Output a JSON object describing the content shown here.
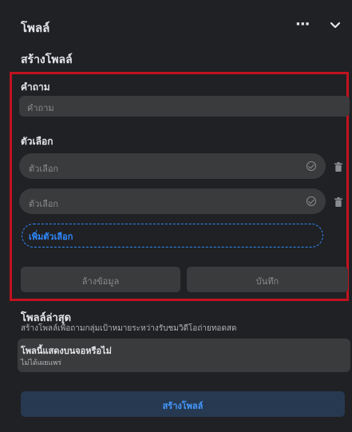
{
  "header": {
    "title": "โพลล์",
    "more_label": "···"
  },
  "subtitle": "สร้างโพลล์",
  "form": {
    "question_label": "คำถาม",
    "question_placeholder": "คำถาม",
    "options_label": "ตัวเลือก",
    "options": [
      {
        "placeholder": "ตัวเลือก"
      },
      {
        "placeholder": "ตัวเลือก"
      }
    ],
    "add_option_label": "เพิ่มตัวเลือก",
    "clear_label": "ล้างข้อมูล",
    "save_label": "บันทึก"
  },
  "recent": {
    "title": "โพลล์ล่าสุด",
    "description": "สร้างโพลล์เพื่อถามกลุ่มเป้าหมายระหว่างรับชมวิดีโอถ่ายทอดสด"
  },
  "display_card": {
    "title": "โพลนี้แสดงบนจอหรือไม่",
    "subtitle": "ไม่ได้เผยแพร่"
  },
  "create_label": "สร้างโพลล์",
  "colors": {
    "background": "#202124",
    "field": "#3a3b3c",
    "accent": "#2e89ff",
    "highlight_border": "#c1121f",
    "create_button": "#263951"
  }
}
